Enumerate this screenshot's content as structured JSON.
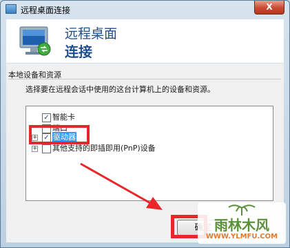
{
  "window": {
    "title": "远程桌面连接",
    "close_label": "X"
  },
  "header": {
    "line1": "远程桌面",
    "line2": "连接"
  },
  "content": {
    "section_title": "本地设备和资源",
    "instruction": "选择要在远程会话中使用的这台计算机上的设备和资源。",
    "tree_items": [
      {
        "label": "智能卡",
        "checked": "✓",
        "expander": ""
      },
      {
        "label": "端口",
        "checked": "",
        "expander": ""
      },
      {
        "label": "驱动器",
        "checked": "✓",
        "expander": "+"
      },
      {
        "label": "其他支持的即插即用(PnP)设备",
        "checked": "",
        "expander": "+"
      }
    ]
  },
  "buttons": {
    "ok": "确定"
  },
  "watermark": {
    "text": "雨林木风",
    "url": "WWW.YLMFU.COM"
  },
  "colors": {
    "annotation_red": "#e8262b",
    "selection_blue": "#3399ff",
    "header_blue": "#1f4e8c"
  },
  "icons": {
    "app": "remote-desktop-icon",
    "close": "close-icon",
    "check": "checkmark-icon",
    "expand": "plus-expander-icon"
  }
}
